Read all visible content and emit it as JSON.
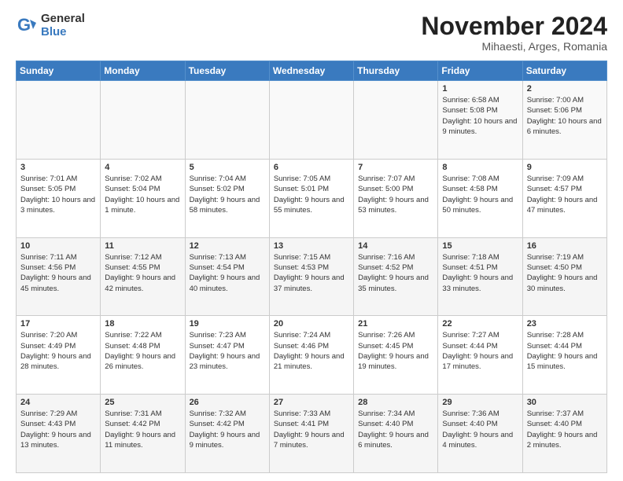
{
  "logo": {
    "line1": "General",
    "line2": "Blue"
  },
  "title": "November 2024",
  "subtitle": "Mihaesti, Arges, Romania",
  "headers": [
    "Sunday",
    "Monday",
    "Tuesday",
    "Wednesday",
    "Thursday",
    "Friday",
    "Saturday"
  ],
  "rows": [
    [
      {
        "day": "",
        "info": ""
      },
      {
        "day": "",
        "info": ""
      },
      {
        "day": "",
        "info": ""
      },
      {
        "day": "",
        "info": ""
      },
      {
        "day": "",
        "info": ""
      },
      {
        "day": "1",
        "info": "Sunrise: 6:58 AM\nSunset: 5:08 PM\nDaylight: 10 hours and 9 minutes."
      },
      {
        "day": "2",
        "info": "Sunrise: 7:00 AM\nSunset: 5:06 PM\nDaylight: 10 hours and 6 minutes."
      }
    ],
    [
      {
        "day": "3",
        "info": "Sunrise: 7:01 AM\nSunset: 5:05 PM\nDaylight: 10 hours and 3 minutes."
      },
      {
        "day": "4",
        "info": "Sunrise: 7:02 AM\nSunset: 5:04 PM\nDaylight: 10 hours and 1 minute."
      },
      {
        "day": "5",
        "info": "Sunrise: 7:04 AM\nSunset: 5:02 PM\nDaylight: 9 hours and 58 minutes."
      },
      {
        "day": "6",
        "info": "Sunrise: 7:05 AM\nSunset: 5:01 PM\nDaylight: 9 hours and 55 minutes."
      },
      {
        "day": "7",
        "info": "Sunrise: 7:07 AM\nSunset: 5:00 PM\nDaylight: 9 hours and 53 minutes."
      },
      {
        "day": "8",
        "info": "Sunrise: 7:08 AM\nSunset: 4:58 PM\nDaylight: 9 hours and 50 minutes."
      },
      {
        "day": "9",
        "info": "Sunrise: 7:09 AM\nSunset: 4:57 PM\nDaylight: 9 hours and 47 minutes."
      }
    ],
    [
      {
        "day": "10",
        "info": "Sunrise: 7:11 AM\nSunset: 4:56 PM\nDaylight: 9 hours and 45 minutes."
      },
      {
        "day": "11",
        "info": "Sunrise: 7:12 AM\nSunset: 4:55 PM\nDaylight: 9 hours and 42 minutes."
      },
      {
        "day": "12",
        "info": "Sunrise: 7:13 AM\nSunset: 4:54 PM\nDaylight: 9 hours and 40 minutes."
      },
      {
        "day": "13",
        "info": "Sunrise: 7:15 AM\nSunset: 4:53 PM\nDaylight: 9 hours and 37 minutes."
      },
      {
        "day": "14",
        "info": "Sunrise: 7:16 AM\nSunset: 4:52 PM\nDaylight: 9 hours and 35 minutes."
      },
      {
        "day": "15",
        "info": "Sunrise: 7:18 AM\nSunset: 4:51 PM\nDaylight: 9 hours and 33 minutes."
      },
      {
        "day": "16",
        "info": "Sunrise: 7:19 AM\nSunset: 4:50 PM\nDaylight: 9 hours and 30 minutes."
      }
    ],
    [
      {
        "day": "17",
        "info": "Sunrise: 7:20 AM\nSunset: 4:49 PM\nDaylight: 9 hours and 28 minutes."
      },
      {
        "day": "18",
        "info": "Sunrise: 7:22 AM\nSunset: 4:48 PM\nDaylight: 9 hours and 26 minutes."
      },
      {
        "day": "19",
        "info": "Sunrise: 7:23 AM\nSunset: 4:47 PM\nDaylight: 9 hours and 23 minutes."
      },
      {
        "day": "20",
        "info": "Sunrise: 7:24 AM\nSunset: 4:46 PM\nDaylight: 9 hours and 21 minutes."
      },
      {
        "day": "21",
        "info": "Sunrise: 7:26 AM\nSunset: 4:45 PM\nDaylight: 9 hours and 19 minutes."
      },
      {
        "day": "22",
        "info": "Sunrise: 7:27 AM\nSunset: 4:44 PM\nDaylight: 9 hours and 17 minutes."
      },
      {
        "day": "23",
        "info": "Sunrise: 7:28 AM\nSunset: 4:44 PM\nDaylight: 9 hours and 15 minutes."
      }
    ],
    [
      {
        "day": "24",
        "info": "Sunrise: 7:29 AM\nSunset: 4:43 PM\nDaylight: 9 hours and 13 minutes."
      },
      {
        "day": "25",
        "info": "Sunrise: 7:31 AM\nSunset: 4:42 PM\nDaylight: 9 hours and 11 minutes."
      },
      {
        "day": "26",
        "info": "Sunrise: 7:32 AM\nSunset: 4:42 PM\nDaylight: 9 hours and 9 minutes."
      },
      {
        "day": "27",
        "info": "Sunrise: 7:33 AM\nSunset: 4:41 PM\nDaylight: 9 hours and 7 minutes."
      },
      {
        "day": "28",
        "info": "Sunrise: 7:34 AM\nSunset: 4:40 PM\nDaylight: 9 hours and 6 minutes."
      },
      {
        "day": "29",
        "info": "Sunrise: 7:36 AM\nSunset: 4:40 PM\nDaylight: 9 hours and 4 minutes."
      },
      {
        "day": "30",
        "info": "Sunrise: 7:37 AM\nSunset: 4:40 PM\nDaylight: 9 hours and 2 minutes."
      }
    ]
  ]
}
